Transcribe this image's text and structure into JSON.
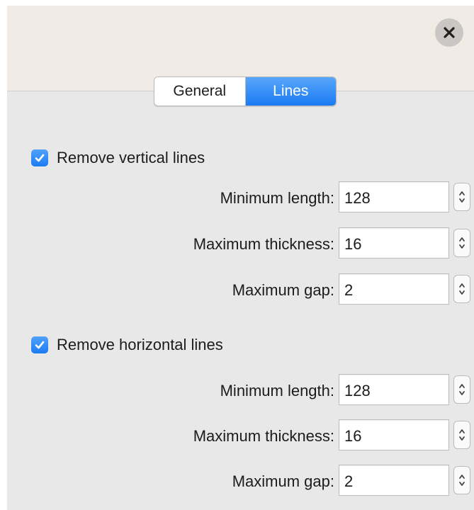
{
  "tabs": [
    {
      "label": "General"
    },
    {
      "label": "Lines",
      "selected": true
    }
  ],
  "vertical": {
    "checkbox_label": "Remove vertical lines",
    "checked": true,
    "fields": [
      {
        "label": "Minimum length:",
        "value": "128"
      },
      {
        "label": "Maximum thickness:",
        "value": "16"
      },
      {
        "label": "Maximum gap:",
        "value": "2"
      }
    ]
  },
  "horizontal": {
    "checkbox_label": "Remove horizontal lines",
    "checked": true,
    "fields": [
      {
        "label": "Minimum length:",
        "value": "128"
      },
      {
        "label": "Maximum thickness:",
        "value": "16"
      },
      {
        "label": "Maximum gap:",
        "value": "2"
      }
    ]
  },
  "colors": {
    "accent": "#1a7bf3",
    "header_bg": "#f1ebe6",
    "panel_bg": "#e8e8e8"
  },
  "icons": {
    "close": "close-icon",
    "check": "checkmark-icon",
    "stepper": "stepper-arrows-icon"
  }
}
